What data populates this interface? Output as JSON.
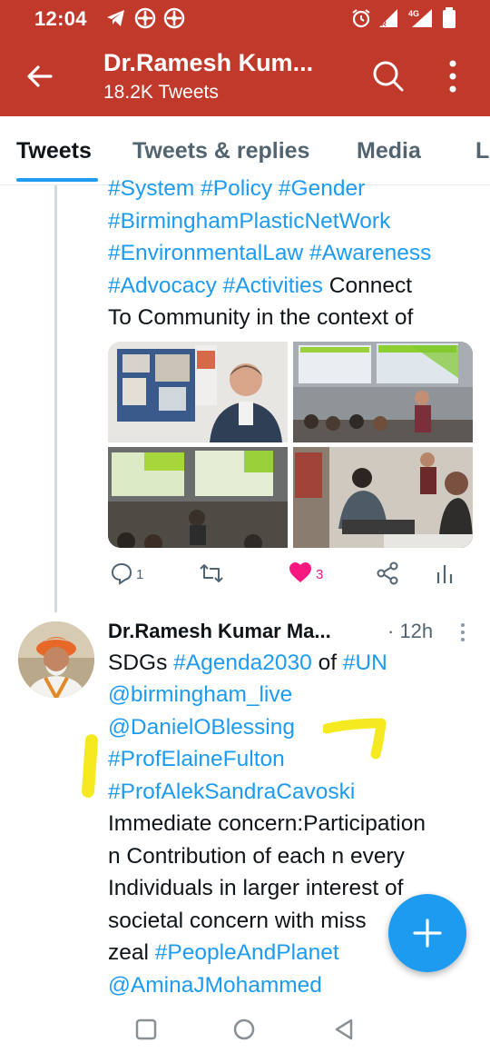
{
  "status_bar": {
    "time": "12:04",
    "icons": [
      "telegram-icon",
      "app-icon",
      "app-icon",
      "alarm-icon",
      "signal-icon",
      "signal-4g-icon",
      "battery-icon"
    ],
    "network_label": "4G"
  },
  "header": {
    "title": "Dr.Ramesh Kum...",
    "subtitle": "18.2K Tweets",
    "bar_color": "#c0392b"
  },
  "tabs": [
    {
      "label": "Tweets",
      "active": true
    },
    {
      "label": "Tweets & replies",
      "active": false
    },
    {
      "label": "Media",
      "active": false
    },
    {
      "label": "L",
      "active": false
    }
  ],
  "tweet1": {
    "lines": [
      "#System #Policy #Gender",
      "#BirminghamPlasticNetWork",
      "#EnvironmentalLaw #Awareness",
      "#Advocacy #Activities",
      " Connect",
      "To Community in the context of"
    ],
    "actions": {
      "replies": "1",
      "likes": "3"
    }
  },
  "tweet2": {
    "author": "Dr.Ramesh Kumar Ma...",
    "time": "· 12h",
    "lines": [
      "SDGs ",
      "#Agenda2030",
      " of ",
      "#UN",
      "@birmingham_live",
      "@DanielOBlessing",
      "#ProfElaineFulton",
      "#ProfAlekSandraCavoski",
      "Immediate concern:Participation",
      "n Contribution of each n every",
      "Individuals in larger interest of",
      "societal concern with miss",
      "zeal ",
      "#PeopleAndPlanet",
      "@AminaJMohammed"
    ]
  },
  "colors": {
    "link": "#1d9bf0",
    "like": "#f91880",
    "highlighter": "#f5ea20"
  }
}
